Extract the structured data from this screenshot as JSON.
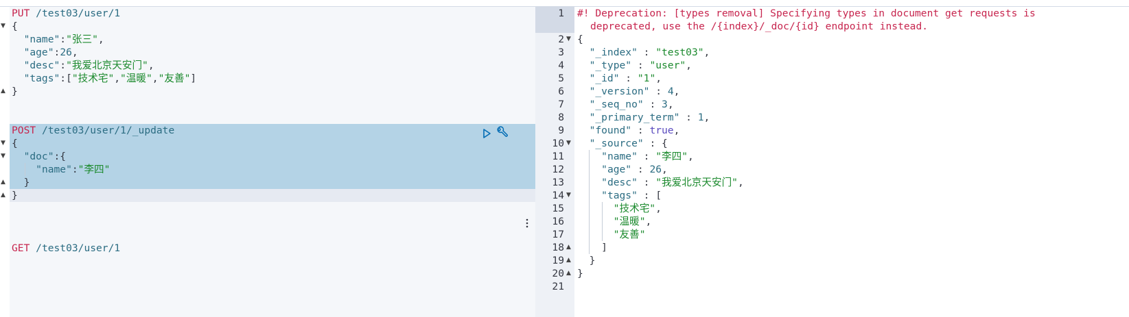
{
  "request_editor": {
    "put_block": {
      "method": "PUT",
      "url": "/test03/user/1",
      "line_open": "{",
      "name_key": "\"name\"",
      "name_val": "\"张三\"",
      "age_key": "\"age\"",
      "age_val": "26",
      "desc_key": "\"desc\"",
      "desc_val": "\"我爱北京天安门\"",
      "tags_key": "\"tags\"",
      "tags_val_1": "\"技术宅\"",
      "tags_val_2": "\"温暖\"",
      "tags_val_3": "\"友善\"",
      "line_close": "}"
    },
    "post_block": {
      "method": "POST",
      "url": "/test03/user/1/_update",
      "line_open": "{",
      "doc_key": "\"doc\"",
      "name_key": "\"name\"",
      "name_val": "\"李四\"",
      "inner_close": "}",
      "line_close": "}"
    },
    "get_block": {
      "method": "GET",
      "url": "/test03/user/1"
    }
  },
  "response_editor": {
    "line_numbers": [
      "1",
      "",
      "2",
      "3",
      "4",
      "5",
      "6",
      "7",
      "8",
      "9",
      "10",
      "11",
      "12",
      "13",
      "14",
      "15",
      "16",
      "17",
      "18",
      "19",
      "20",
      "21"
    ],
    "warning_line_1": "#! Deprecation: [types removal] Specifying types in document get requests is",
    "warning_line_2": "deprecated, use the /{index}/_doc/{id} endpoint instead.",
    "lines": {
      "index_key": "\"_index\"",
      "index_val": "\"test03\"",
      "type_key": "\"_type\"",
      "type_val": "\"user\"",
      "id_key": "\"_id\"",
      "id_val": "\"1\"",
      "version_key": "\"_version\"",
      "version_val": "4",
      "seq_key": "\"_seq_no\"",
      "seq_val": "3",
      "primary_key": "\"_primary_term\"",
      "primary_val": "1",
      "found_key": "\"found\"",
      "found_val": "true",
      "source_key": "\"_source\"",
      "name_key": "\"name\"",
      "name_val": "\"李四\"",
      "age_key": "\"age\"",
      "age_val": "26",
      "desc_key": "\"desc\"",
      "desc_val": "\"我爱北京天安门\"",
      "tags_key": "\"tags\"",
      "tag_1": "\"技术宅\"",
      "tag_2": "\"温暖\"",
      "tag_3": "\"友善\""
    }
  },
  "colors": {
    "selection": "#b4d3e6",
    "method": "#c7254e",
    "string": "#1c8a2e",
    "key": "#2b6c82",
    "bool": "#5a4bbf"
  }
}
